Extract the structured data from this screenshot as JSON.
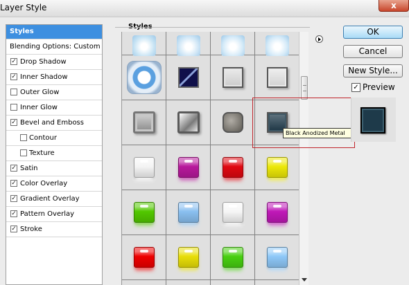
{
  "window": {
    "title": "Layer Style",
    "close_glyph": "x"
  },
  "sidebar": {
    "items": [
      {
        "label": "Styles",
        "checkbox": false,
        "checked": false,
        "selected": true,
        "indent": false
      },
      {
        "label": "Blending Options: Custom",
        "checkbox": false,
        "checked": false,
        "selected": false,
        "indent": false
      },
      {
        "label": "Drop Shadow",
        "checkbox": true,
        "checked": true,
        "selected": false,
        "indent": false
      },
      {
        "label": "Inner Shadow",
        "checkbox": true,
        "checked": true,
        "selected": false,
        "indent": false
      },
      {
        "label": "Outer Glow",
        "checkbox": true,
        "checked": false,
        "selected": false,
        "indent": false
      },
      {
        "label": "Inner Glow",
        "checkbox": true,
        "checked": false,
        "selected": false,
        "indent": false
      },
      {
        "label": "Bevel and Emboss",
        "checkbox": true,
        "checked": true,
        "selected": false,
        "indent": false
      },
      {
        "label": "Contour",
        "checkbox": true,
        "checked": false,
        "selected": false,
        "indent": true
      },
      {
        "label": "Texture",
        "checkbox": true,
        "checked": false,
        "selected": false,
        "indent": true
      },
      {
        "label": "Satin",
        "checkbox": true,
        "checked": true,
        "selected": false,
        "indent": false
      },
      {
        "label": "Color Overlay",
        "checkbox": true,
        "checked": true,
        "selected": false,
        "indent": false
      },
      {
        "label": "Gradient Overlay",
        "checkbox": true,
        "checked": true,
        "selected": false,
        "indent": false
      },
      {
        "label": "Pattern Overlay",
        "checkbox": true,
        "checked": true,
        "selected": false,
        "indent": false
      },
      {
        "label": "Stroke",
        "checkbox": true,
        "checked": true,
        "selected": false,
        "indent": false
      }
    ]
  },
  "styles_panel": {
    "label": "Styles",
    "swatches": [
      {
        "kind": "partial",
        "color": "#c8e4f4"
      },
      {
        "kind": "partial",
        "color": "#cfe6f6"
      },
      {
        "kind": "partial",
        "color": "#d4eaf8"
      },
      {
        "kind": "partial",
        "color": "#d4eaf8"
      },
      {
        "kind": "ring",
        "color": "#5aa0e0"
      },
      {
        "kind": "diag",
        "color": "#10104a"
      },
      {
        "kind": "square",
        "color": "#e2e2e2"
      },
      {
        "kind": "square",
        "color": "#e8e8e8"
      },
      {
        "kind": "bevel",
        "color": "#b8b8b8"
      },
      {
        "kind": "chrome",
        "color": "#a8a8a8"
      },
      {
        "kind": "rounded",
        "color": "#8f8a80"
      },
      {
        "kind": "square",
        "color": "#1e3a4a"
      },
      {
        "kind": "glossy",
        "color": "#f4f4f4"
      },
      {
        "kind": "glossy",
        "color": "#b8199c"
      },
      {
        "kind": "glossy",
        "color": "#e00810"
      },
      {
        "kind": "glossy",
        "color": "#ece808"
      },
      {
        "kind": "glossy",
        "color": "#52c800"
      },
      {
        "kind": "glossy",
        "color": "#8ac0f0"
      },
      {
        "kind": "glossy",
        "color": "#f6f6f6"
      },
      {
        "kind": "glossy",
        "color": "#c018b8"
      },
      {
        "kind": "glossy",
        "color": "#ee0000"
      },
      {
        "kind": "glossy",
        "color": "#e8de08"
      },
      {
        "kind": "glossy",
        "color": "#48d010"
      },
      {
        "kind": "glossy",
        "color": "#8ec8f8"
      }
    ]
  },
  "tooltip": {
    "text": "Black Anodized Metal"
  },
  "buttons": {
    "ok": "OK",
    "cancel": "Cancel",
    "new_style": "New Style..."
  },
  "preview": {
    "label": "Preview",
    "checked": true,
    "check_glyph": "✓",
    "swatch_color": "#1e3a4a"
  }
}
